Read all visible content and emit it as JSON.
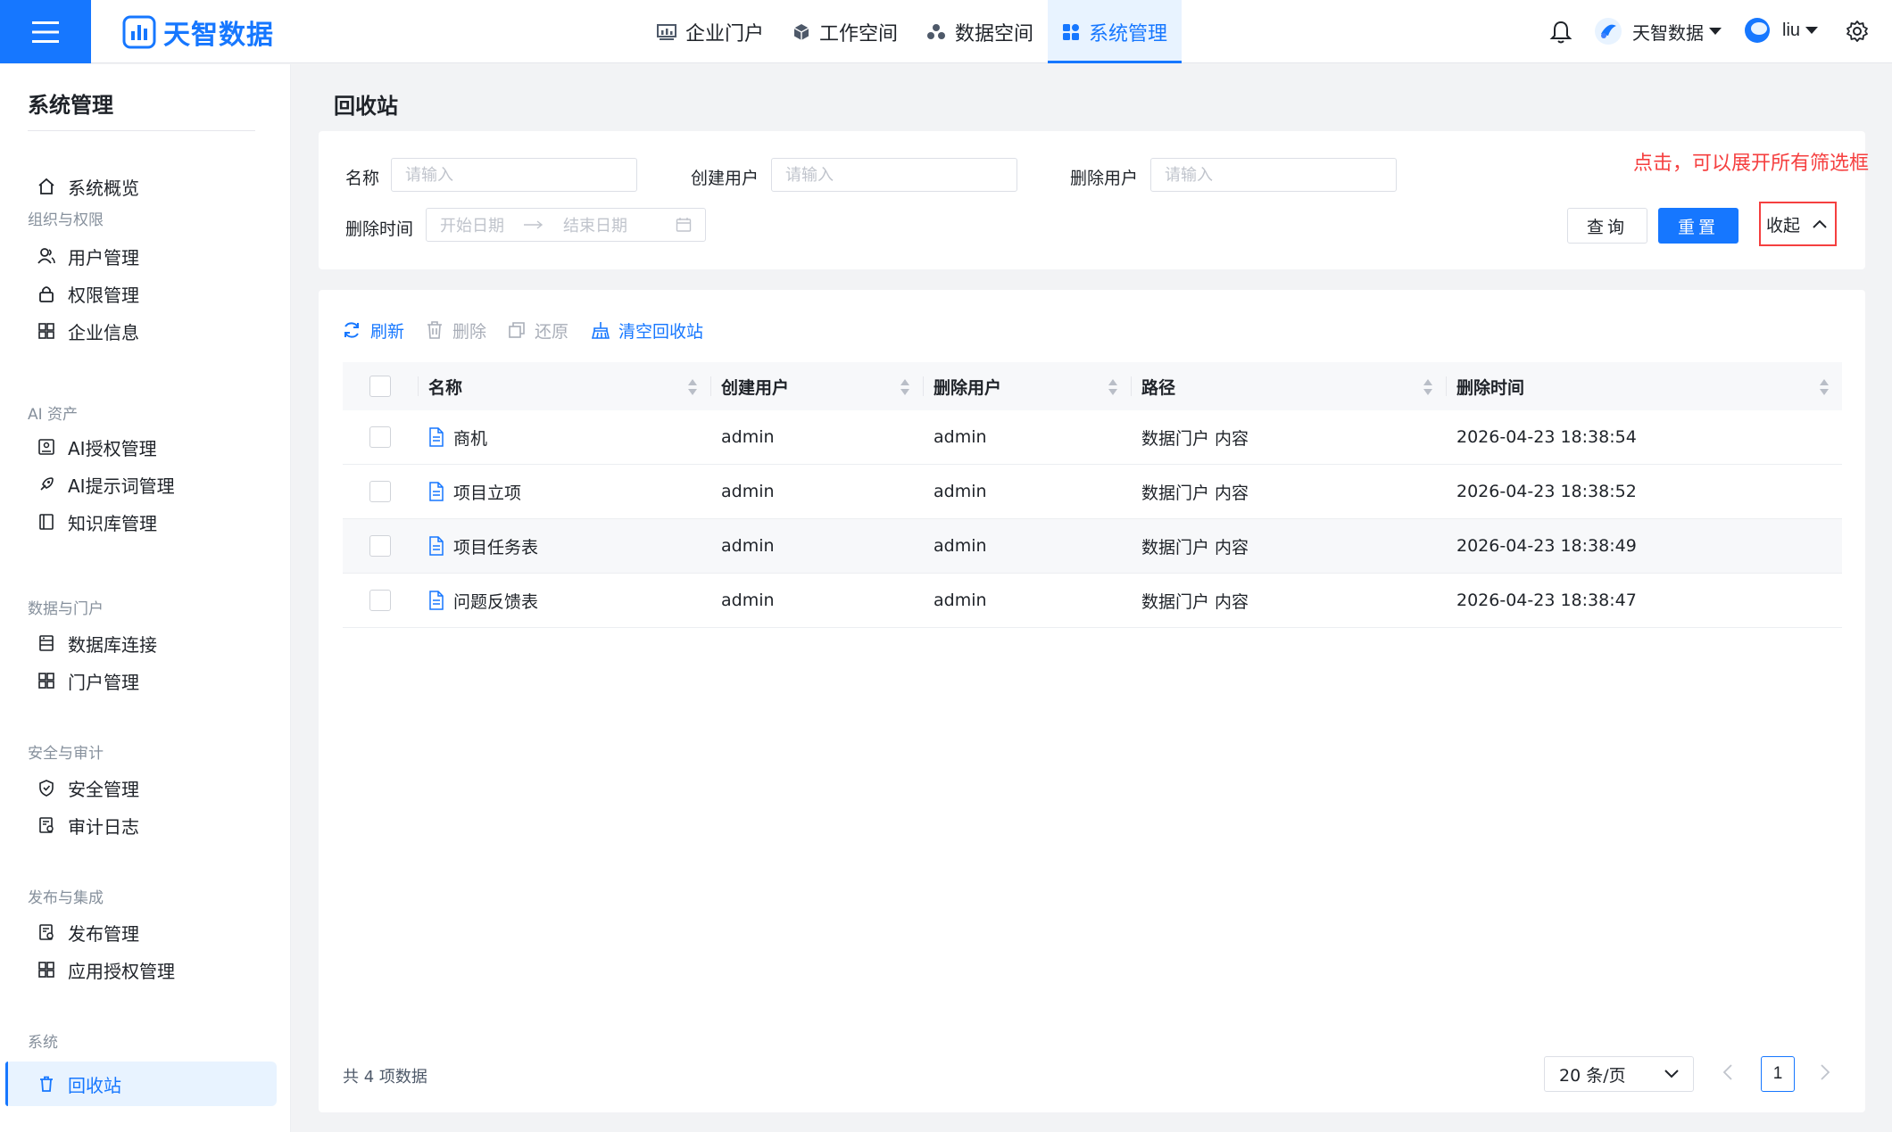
{
  "colors": {
    "primary": "#1677ff",
    "annotation": "#f53f3f",
    "muted": "#86909c"
  },
  "header": {
    "logo_text": "天智数据",
    "nav": [
      {
        "label": "企业门户",
        "icon": "chart-icon"
      },
      {
        "label": "工作空间",
        "icon": "cube-icon"
      },
      {
        "label": "数据空间",
        "icon": "cubes-icon"
      },
      {
        "label": "系统管理",
        "icon": "grid-icon",
        "active": true
      }
    ],
    "org_name": "天智数据",
    "user_name": "liu"
  },
  "sidebar": {
    "title": "系统管理",
    "overview": "系统概览",
    "groups": [
      {
        "label": "组织与权限",
        "items": [
          "用户管理",
          "权限管理",
          "企业信息"
        ]
      },
      {
        "label": "AI 资产",
        "items": [
          "AI授权管理",
          "AI提示词管理",
          "知识库管理"
        ]
      },
      {
        "label": "数据与门户",
        "items": [
          "数据库连接",
          "门户管理"
        ]
      },
      {
        "label": "安全与审计",
        "items": [
          "安全管理",
          "审计日志"
        ]
      },
      {
        "label": "发布与集成",
        "items": [
          "发布管理",
          "应用授权管理"
        ]
      },
      {
        "label": "系统",
        "items": [
          "回收站"
        ]
      }
    ]
  },
  "page": {
    "title": "回收站"
  },
  "filter": {
    "name_label": "名称",
    "creator_label": "创建用户",
    "deleter_label": "删除用户",
    "time_label": "删除时间",
    "placeholder": "请输入",
    "start_placeholder": "开始日期",
    "end_placeholder": "结束日期",
    "query_button": "查询",
    "reset_button": "重置",
    "collapse_button": "收起",
    "annotation": "点击，可以展开所有筛选框"
  },
  "toolbar": {
    "refresh": "刷新",
    "delete": "删除",
    "restore": "还原",
    "empty": "清空回收站"
  },
  "table": {
    "columns": [
      "名称",
      "创建用户",
      "删除用户",
      "路径",
      "删除时间"
    ],
    "rows": [
      {
        "name": "商机",
        "creator": "admin",
        "deleter": "admin",
        "path": "数据门户 内容",
        "time": "2026-04-23 18:38:54"
      },
      {
        "name": "项目立项",
        "creator": "admin",
        "deleter": "admin",
        "path": "数据门户 内容",
        "time": "2026-04-23 18:38:52"
      },
      {
        "name": "项目任务表",
        "creator": "admin",
        "deleter": "admin",
        "path": "数据门户 内容",
        "time": "2026-04-23 18:38:49"
      },
      {
        "name": "问题反馈表",
        "creator": "admin",
        "deleter": "admin",
        "path": "数据门户 内容",
        "time": "2026-04-23 18:38:47"
      }
    ]
  },
  "pagination": {
    "total_text": "共 4 项数据",
    "page_size": "20 条/页",
    "current_page": "1"
  }
}
